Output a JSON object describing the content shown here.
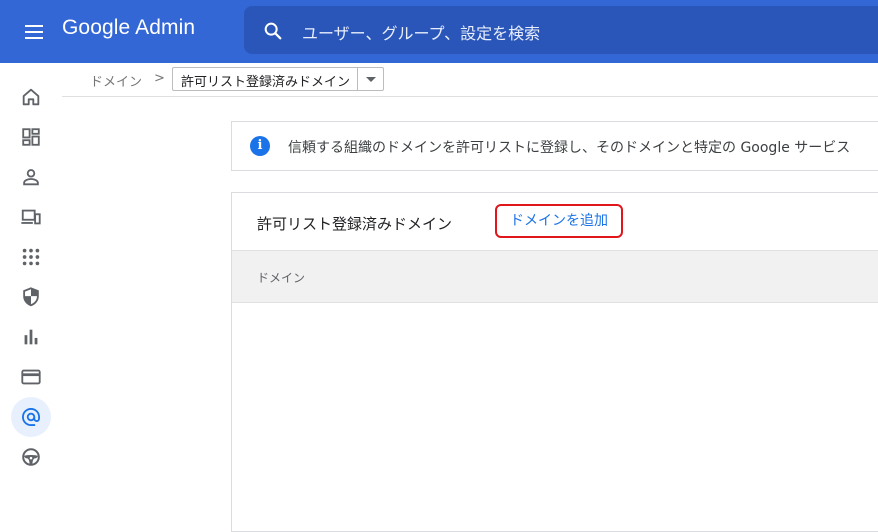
{
  "app": {
    "title": "Google Admin"
  },
  "colors": {
    "header_bg": "#3467d6",
    "accent": "#1a73e8",
    "highlight_border": "#e0161b"
  },
  "search": {
    "placeholder": "ユーザー、グループ、設定を検索"
  },
  "rail": {
    "items": [
      {
        "icon": "home-icon"
      },
      {
        "icon": "dashboard-icon"
      },
      {
        "icon": "user-icon"
      },
      {
        "icon": "devices-icon"
      },
      {
        "icon": "apps-icon"
      },
      {
        "icon": "security-shield-icon"
      },
      {
        "icon": "reports-bar-chart-icon"
      },
      {
        "icon": "billing-card-icon"
      },
      {
        "icon": "domains-at-icon",
        "active": true
      },
      {
        "icon": "support-wheel-icon"
      }
    ]
  },
  "breadcrumb": {
    "root": "ドメイン",
    "separator": ">",
    "current": "許可リスト登録済みドメイン"
  },
  "info_banner": {
    "text": "信頼する組織のドメインを許可リストに登録し、そのドメインと特定の Google サービス"
  },
  "card": {
    "title": "許可リスト登録済みドメイン",
    "add_button": "ドメインを追加",
    "columns": [
      "ドメイン"
    ],
    "rows": []
  }
}
